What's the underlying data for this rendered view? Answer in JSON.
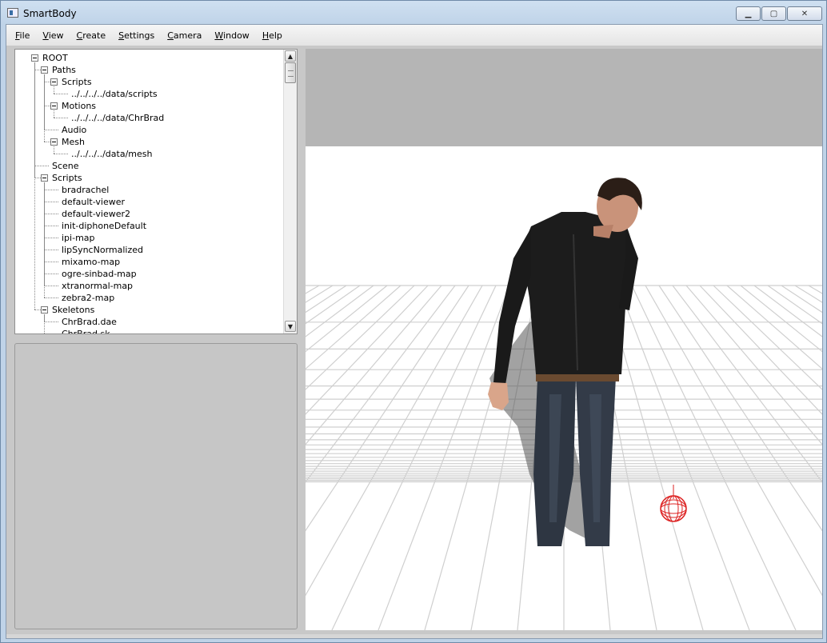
{
  "window": {
    "title": "SmartBody",
    "minimize_glyph": "▁",
    "maximize_glyph": "▢",
    "close_glyph": "✕"
  },
  "menu": [
    {
      "label": "File",
      "mnemonic": "F",
      "rest": "ile"
    },
    {
      "label": "View",
      "mnemonic": "V",
      "rest": "iew"
    },
    {
      "label": "Create",
      "mnemonic": "C",
      "rest": "reate"
    },
    {
      "label": "Settings",
      "mnemonic": "S",
      "rest": "ettings"
    },
    {
      "label": "Camera",
      "mnemonic": "C",
      "rest": "amera"
    },
    {
      "label": "Window",
      "mnemonic": "W",
      "rest": "indow"
    },
    {
      "label": "Help",
      "mnemonic": "H",
      "rest": "elp"
    }
  ],
  "tree": {
    "items": [
      {
        "label": "ROOT",
        "level": 0,
        "expandable": true
      },
      {
        "label": "Paths",
        "level": 1,
        "expandable": true
      },
      {
        "label": "Scripts",
        "level": 2,
        "expandable": true
      },
      {
        "label": "../../../../data/scripts",
        "level": 3,
        "expandable": false
      },
      {
        "label": "Motions",
        "level": 2,
        "expandable": true
      },
      {
        "label": "../../../../data/ChrBrad",
        "level": 3,
        "expandable": false
      },
      {
        "label": "Audio",
        "level": 2,
        "expandable": false
      },
      {
        "label": "Mesh",
        "level": 2,
        "expandable": true
      },
      {
        "label": "../../../../data/mesh",
        "level": 3,
        "expandable": false
      },
      {
        "label": "Scene",
        "level": 1,
        "expandable": false
      },
      {
        "label": "Scripts",
        "level": 1,
        "expandable": true
      },
      {
        "label": "bradrachel",
        "level": 2,
        "expandable": false
      },
      {
        "label": "default-viewer",
        "level": 2,
        "expandable": false
      },
      {
        "label": "default-viewer2",
        "level": 2,
        "expandable": false
      },
      {
        "label": "init-diphoneDefault",
        "level": 2,
        "expandable": false
      },
      {
        "label": "ipi-map",
        "level": 2,
        "expandable": false
      },
      {
        "label": "lipSyncNormalized",
        "level": 2,
        "expandable": false
      },
      {
        "label": "mixamo-map",
        "level": 2,
        "expandable": false
      },
      {
        "label": "ogre-sinbad-map",
        "level": 2,
        "expandable": false
      },
      {
        "label": "xtranormal-map",
        "level": 2,
        "expandable": false
      },
      {
        "label": "zebra2-map",
        "level": 2,
        "expandable": false
      },
      {
        "label": "Skeletons",
        "level": 1,
        "expandable": true
      },
      {
        "label": "ChrBrad.dae",
        "level": 2,
        "expandable": false
      },
      {
        "label": "ChrBrad.sk",
        "level": 2,
        "expandable": false
      }
    ]
  },
  "scrollbar": {
    "up_glyph": "▲",
    "down_glyph": "▼"
  }
}
